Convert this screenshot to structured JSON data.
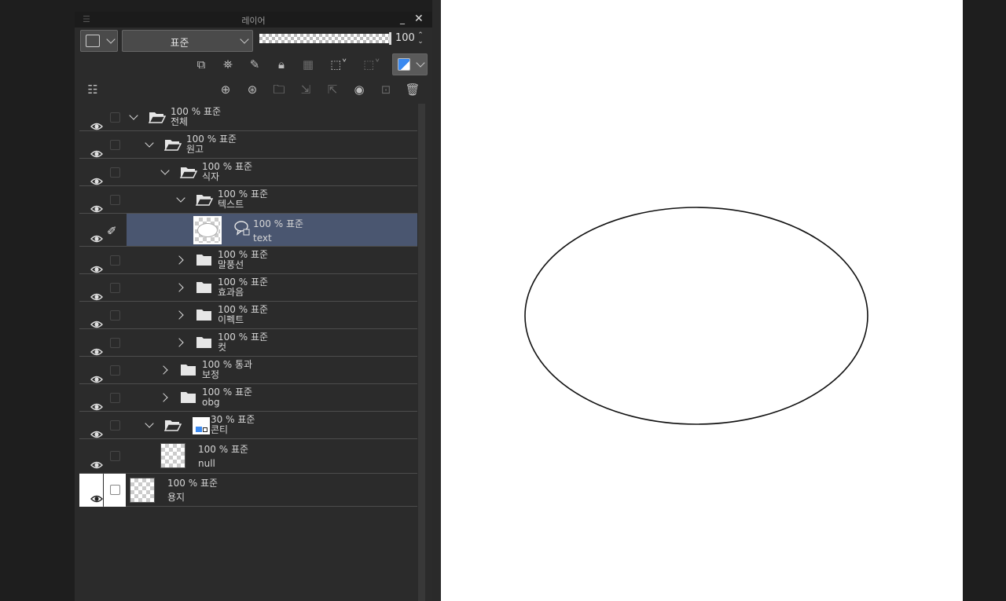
{
  "panel": {
    "title": "레이어",
    "blend_mode": "표준",
    "opacity": "100",
    "color_swatch": "#3b8af0"
  },
  "layers": [
    {
      "percent": "100 %",
      "mode": "표준",
      "name": "전체",
      "type": "folder",
      "expanded": true
    },
    {
      "percent": "100 %",
      "mode": "표준",
      "name": "원고",
      "type": "folder",
      "expanded": true
    },
    {
      "percent": "100 %",
      "mode": "표준",
      "name": "식자",
      "type": "folder",
      "expanded": true
    },
    {
      "percent": "100 %",
      "mode": "표준",
      "name": "텍스트",
      "type": "folder",
      "expanded": true
    },
    {
      "percent": "100 %",
      "mode": "표준",
      "name": "text",
      "type": "text-layer",
      "selected": true
    },
    {
      "percent": "100 %",
      "mode": "표준",
      "name": "말풍선",
      "type": "folder",
      "expanded": false
    },
    {
      "percent": "100 %",
      "mode": "표준",
      "name": "효과음",
      "type": "folder",
      "expanded": false
    },
    {
      "percent": "100 %",
      "mode": "표준",
      "name": "이펙트",
      "type": "folder",
      "expanded": false
    },
    {
      "percent": "100 %",
      "mode": "표준",
      "name": "컷",
      "type": "folder",
      "expanded": false
    },
    {
      "percent": "100 %",
      "mode": "통과",
      "name": "보정",
      "type": "folder",
      "expanded": false
    },
    {
      "percent": "100 %",
      "mode": "표준",
      "name": "obg",
      "type": "folder",
      "expanded": false
    },
    {
      "percent": "30 %",
      "mode": "표준",
      "name": "콘티",
      "type": "folder",
      "expanded": true
    },
    {
      "percent": "100 %",
      "mode": "표준",
      "name": "null",
      "type": "raster"
    },
    {
      "percent": "100 %",
      "mode": "표준",
      "name": "용지",
      "type": "paper"
    }
  ]
}
